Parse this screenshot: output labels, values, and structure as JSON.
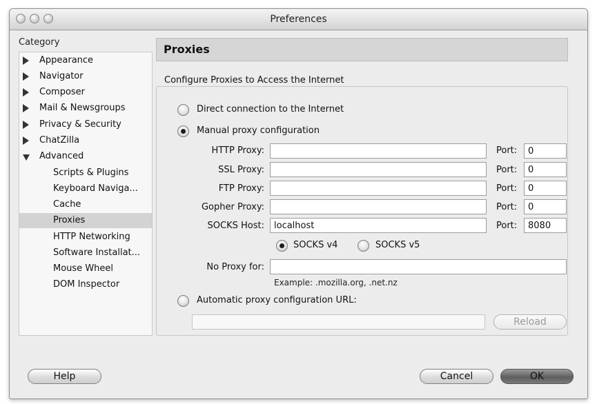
{
  "window": {
    "title": "Preferences"
  },
  "category": {
    "label": "Category",
    "items": [
      {
        "label": "Appearance",
        "expander": "right"
      },
      {
        "label": "Navigator",
        "expander": "right"
      },
      {
        "label": "Composer",
        "expander": "right"
      },
      {
        "label": "Mail & Newsgroups",
        "expander": "right"
      },
      {
        "label": "Privacy & Security",
        "expander": "right"
      },
      {
        "label": "ChatZilla",
        "expander": "right"
      },
      {
        "label": "Advanced",
        "expander": "down"
      },
      {
        "label": "Scripts & Plugins"
      },
      {
        "label": "Keyboard Naviga..."
      },
      {
        "label": "Cache"
      },
      {
        "label": "Proxies",
        "selected": true
      },
      {
        "label": "HTTP Networking"
      },
      {
        "label": "Software Installat..."
      },
      {
        "label": "Mouse Wheel"
      },
      {
        "label": "DOM Inspector"
      }
    ]
  },
  "panel": {
    "header": "Proxies",
    "group_title": "Configure Proxies to Access the Internet",
    "direct_label": "Direct connection to the Internet",
    "manual_label": "Manual proxy configuration",
    "auto_label": "Automatic proxy configuration URL:",
    "selected_mode": "manual",
    "port_label": "Port:",
    "proxies": [
      {
        "label": "HTTP Proxy:",
        "host": "",
        "port": "0"
      },
      {
        "label": "SSL Proxy:",
        "host": "",
        "port": "0"
      },
      {
        "label": "FTP Proxy:",
        "host": "",
        "port": "0"
      },
      {
        "label": "Gopher Proxy:",
        "host": "",
        "port": "0"
      },
      {
        "label": "SOCKS Host:",
        "host": "localhost",
        "port": "8080"
      }
    ],
    "socks_v4_label": "SOCKS v4",
    "socks_v5_label": "SOCKS v5",
    "socks_selected": "v4",
    "no_proxy_label": "No Proxy for:",
    "no_proxy_value": "",
    "example_text": "Example: .mozilla.org, .net.nz",
    "auto_url_value": "",
    "reload_label": "Reload"
  },
  "footer": {
    "help_label": "Help",
    "cancel_label": "Cancel",
    "ok_label": "OK"
  }
}
